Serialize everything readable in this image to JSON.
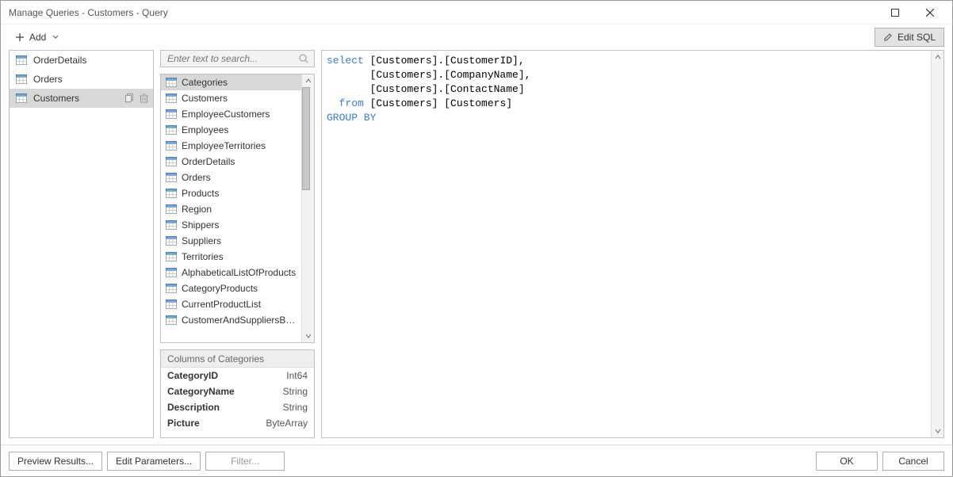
{
  "window": {
    "title": "Manage Queries - Customers - Query"
  },
  "toolbar": {
    "add_label": "Add",
    "edit_sql_label": "Edit SQL"
  },
  "sidebar": {
    "items": [
      {
        "label": "OrderDetails",
        "selected": false
      },
      {
        "label": "Orders",
        "selected": false
      },
      {
        "label": "Customers",
        "selected": true
      }
    ]
  },
  "search": {
    "placeholder": "Enter text to search..."
  },
  "tables": [
    "Categories",
    "Customers",
    "EmployeeCustomers",
    "Employees",
    "EmployeeTerritories",
    "OrderDetails",
    "Orders",
    "Products",
    "Region",
    "Shippers",
    "Suppliers",
    "Territories",
    "AlphabeticalListOfProducts",
    "CategoryProducts",
    "CurrentProductList",
    "CustomerAndSuppliersByCity"
  ],
  "tables_selected_index": 0,
  "columns": {
    "header": "Columns of Categories",
    "rows": [
      {
        "name": "CategoryID",
        "type": "Int64"
      },
      {
        "name": "CategoryName",
        "type": "String"
      },
      {
        "name": "Description",
        "type": "String"
      },
      {
        "name": "Picture",
        "type": "ByteArray"
      }
    ]
  },
  "sql": {
    "l1a": "select",
    "l1b": " [Customers].[CustomerID],",
    "l2": "       [Customers].[CompanyName],",
    "l3": "       [Customers].[ContactName]",
    "l4a": "  from",
    "l4b": " [Customers] [Customers]",
    "l5": "GROUP BY"
  },
  "footer": {
    "preview": "Preview Results...",
    "edit_params": "Edit Parameters...",
    "filter": "Filter...",
    "ok": "OK",
    "cancel": "Cancel"
  }
}
